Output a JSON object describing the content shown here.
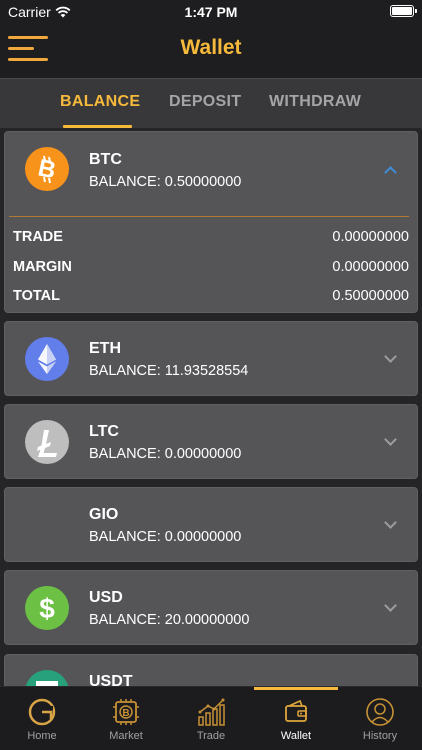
{
  "status_bar": {
    "carrier": "Carrier",
    "time": "1:47 PM"
  },
  "header": {
    "title": "Wallet"
  },
  "tabs": [
    {
      "label": "BALANCE",
      "active": true
    },
    {
      "label": "DEPOSIT",
      "active": false
    },
    {
      "label": "WITHDRAW",
      "active": false
    }
  ],
  "coins": [
    {
      "symbol": "BTC",
      "balance": "BALANCE: 0.50000000",
      "expanded": true,
      "icon": "bitcoin-icon",
      "color": "#f7931a",
      "details": [
        {
          "label": "TRADE",
          "value": "0.00000000"
        },
        {
          "label": "MARGIN",
          "value": "0.00000000"
        },
        {
          "label": "TOTAL",
          "value": "0.50000000"
        }
      ]
    },
    {
      "symbol": "ETH",
      "balance": "BALANCE: 11.93528554",
      "expanded": false,
      "icon": "ethereum-icon",
      "color": "#627eea"
    },
    {
      "symbol": "LTC",
      "balance": "BALANCE: 0.00000000",
      "expanded": false,
      "icon": "litecoin-icon",
      "color": "#bebebe"
    },
    {
      "symbol": "GIO",
      "balance": "BALANCE: 0.00000000",
      "expanded": false,
      "icon": "none"
    },
    {
      "symbol": "USD",
      "balance": "BALANCE: 20.00000000",
      "expanded": false,
      "icon": "dollar-icon",
      "color": "#6cc043"
    },
    {
      "symbol": "USDT",
      "balance": "",
      "expanded": false,
      "icon": "tether-icon",
      "color": "#26a17b"
    }
  ],
  "tab_bar": [
    {
      "label": "Home",
      "icon": "home-icon",
      "active": false
    },
    {
      "label": "Market",
      "icon": "market-icon",
      "active": false
    },
    {
      "label": "Trade",
      "icon": "trade-icon",
      "active": false
    },
    {
      "label": "Wallet",
      "icon": "wallet-icon",
      "active": true
    },
    {
      "label": "History",
      "icon": "history-icon",
      "active": false
    }
  ],
  "colors": {
    "accent": "#f6b93b",
    "background": "#252527",
    "card": "#555558"
  }
}
